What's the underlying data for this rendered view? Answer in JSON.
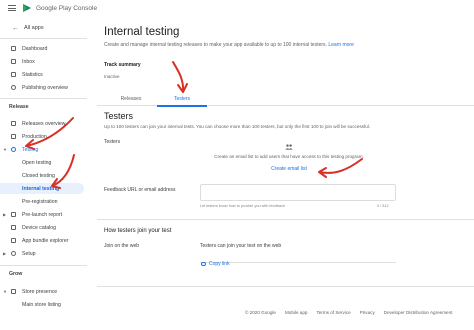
{
  "topbar": {
    "brand": "Google Play Console"
  },
  "sidebar": {
    "back_label": "All apps",
    "top_items": [
      {
        "label": "Dashboard"
      },
      {
        "label": "Inbox"
      },
      {
        "label": "Statistics"
      },
      {
        "label": "Publishing overview"
      }
    ],
    "release_section": "Release",
    "release_items": [
      {
        "label": "Releases overview"
      },
      {
        "label": "Production"
      },
      {
        "label": "Testing"
      },
      {
        "label": "Open testing"
      },
      {
        "label": "Closed testing"
      },
      {
        "label": "Internal testing"
      },
      {
        "label": "Pre-registration"
      },
      {
        "label": "Pre-launch report"
      },
      {
        "label": "Device catalog"
      },
      {
        "label": "App bundle explorer"
      },
      {
        "label": "Setup"
      }
    ],
    "grow_section": "Grow",
    "grow_items": [
      {
        "label": "Store presence"
      },
      {
        "label": "Main store listing"
      }
    ]
  },
  "main": {
    "title": "Internal testing",
    "subtitle": "Create and manage internal testing releases to make your app available to up to 100 internal testers.",
    "learn_more": "Learn more",
    "track_summary_label": "Track summary",
    "track_summary_value": "Inactive",
    "tabs": [
      {
        "label": "Releases"
      },
      {
        "label": "Testers"
      }
    ],
    "testers_title": "Testers",
    "testers_desc": "Up to 100 testers can join your internal tests. You can choose more than 100 testers, but only the first 100 to join will be successful.",
    "testers_label": "Testers",
    "empty_message": "Create an email list to add users that have access to this testing program.",
    "create_email_list": "Create email list",
    "feedback_label": "Feedback URL or email address",
    "feedback_hint": "Let testers know how to provide you with feedback",
    "feedback_count": "0 / 512",
    "how_join_title": "How testers join your test",
    "join_web_label": "Join on the web",
    "join_web_desc": "Testers can join your test on the web",
    "copy_link": "Copy link"
  },
  "footer": {
    "items": [
      "© 2020 Google",
      "Mobile app",
      "Terms of Service",
      "Privacy",
      "Developer Distribution Agreement"
    ]
  },
  "colors": {
    "accent": "#1a73e8",
    "selected_bg": "#e8f0fe",
    "annotation_arrow": "#d93025"
  }
}
